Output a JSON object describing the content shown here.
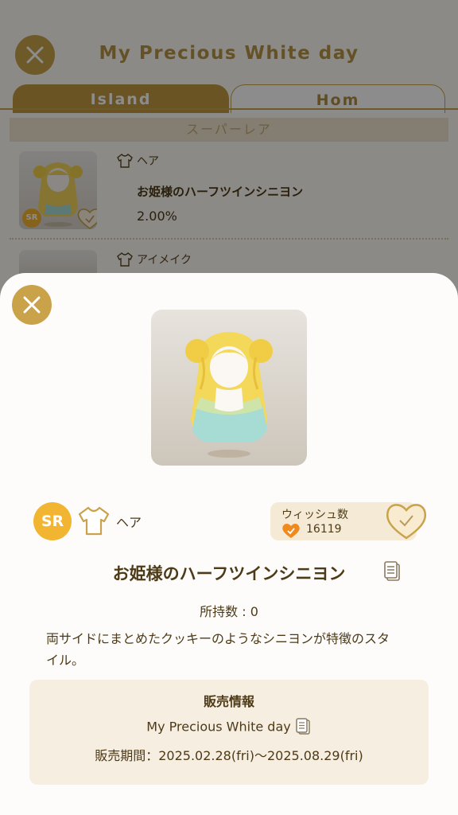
{
  "background": {
    "title": "My Precious White day",
    "tabs": [
      {
        "label": "Island",
        "active": true
      },
      {
        "label": "Hom",
        "active": false
      }
    ],
    "rarity_header": "スーパーレア",
    "items": [
      {
        "rarity": "SR",
        "category": "ヘア",
        "name": "お姫様のハーフツインシニヨン",
        "rate": "2.00%"
      },
      {
        "category": "アイメイク"
      }
    ]
  },
  "detail": {
    "rarity": "SR",
    "category": "ヘア",
    "wishlist": {
      "label": "ウィッシュ数",
      "count": "16119",
      "checked": true
    },
    "item_name": "お姫様のハーフツインシニヨン",
    "owned_label": "所持数 : ",
    "owned_count": "0",
    "description": "両サイドにまとめたクッキーのようなシニヨンが特徴のスタイル。",
    "sale": {
      "heading": "販売情報",
      "event": "My Precious White day",
      "period": "販売期間：2025.02.28(fri)〜2025.08.29(fri)"
    }
  },
  "icons": [
    "close-icon",
    "shirt-icon",
    "heart-check-icon",
    "document-icon",
    "check-icon"
  ],
  "colors": {
    "accent_gold": "#c9a24a",
    "sr_badge": "#f2b531",
    "wish_orange": "#f08a1c",
    "text_brown": "#4d3a17"
  }
}
